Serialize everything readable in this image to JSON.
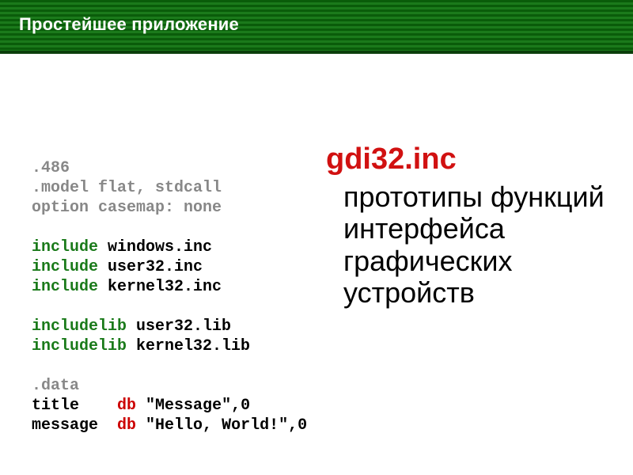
{
  "header": {
    "title": "Простейшее приложение"
  },
  "code": {
    "l1": ".486",
    "l2": ".model flat, stdcall",
    "l3": "option casemap: none",
    "l4_kw": "include",
    "l4_arg": " windows.inc",
    "l5_kw": "include",
    "l5_arg": " user32.inc",
    "l6_kw": "include",
    "l6_arg": " kernel32.inc",
    "l7_kw": "includelib",
    "l7_arg": " user32.lib",
    "l8_kw": "includelib",
    "l8_arg": " kernel32.lib",
    "l9": ".data",
    "l10_name": "title    ",
    "l10_kw": "db",
    "l10_val": " \"Message\",0",
    "l11_name": "message  ",
    "l11_kw": "db",
    "l11_val": " \"Hello, World!\",0"
  },
  "right": {
    "heading": "gdi32.inc",
    "desc": "прототипы функций интерфейса графических устройств"
  }
}
